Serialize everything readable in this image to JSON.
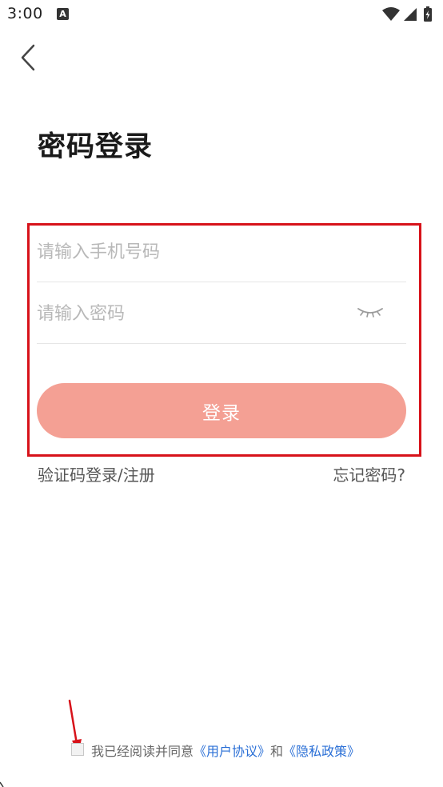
{
  "status_bar": {
    "time": "3:00",
    "notification_letter": "A"
  },
  "header": {
    "title": "密码登录"
  },
  "form": {
    "phone_placeholder": "请输入手机号码",
    "phone_value": "",
    "password_placeholder": "请输入密码",
    "password_value": "",
    "login_label": "登录"
  },
  "links": {
    "sms_login": "验证码登录/注册",
    "forgot_password": "忘记密码?"
  },
  "agreement": {
    "prefix": "我已经阅读并同意",
    "user_agreement": "《用户协议》",
    "conjunction": "和",
    "privacy_policy": "《隐私政策》",
    "checked": false
  },
  "colors": {
    "primary_button": "#f4a094",
    "highlight_border": "#d7121a",
    "link_blue": "#2a6fd6",
    "annotation_arrow": "#d7121a"
  },
  "icons": {
    "back": "chevron-left-icon",
    "password_visibility": "eye-closed-icon",
    "wifi": "wifi-icon",
    "signal": "signal-icon",
    "battery": "battery-charging-icon"
  }
}
